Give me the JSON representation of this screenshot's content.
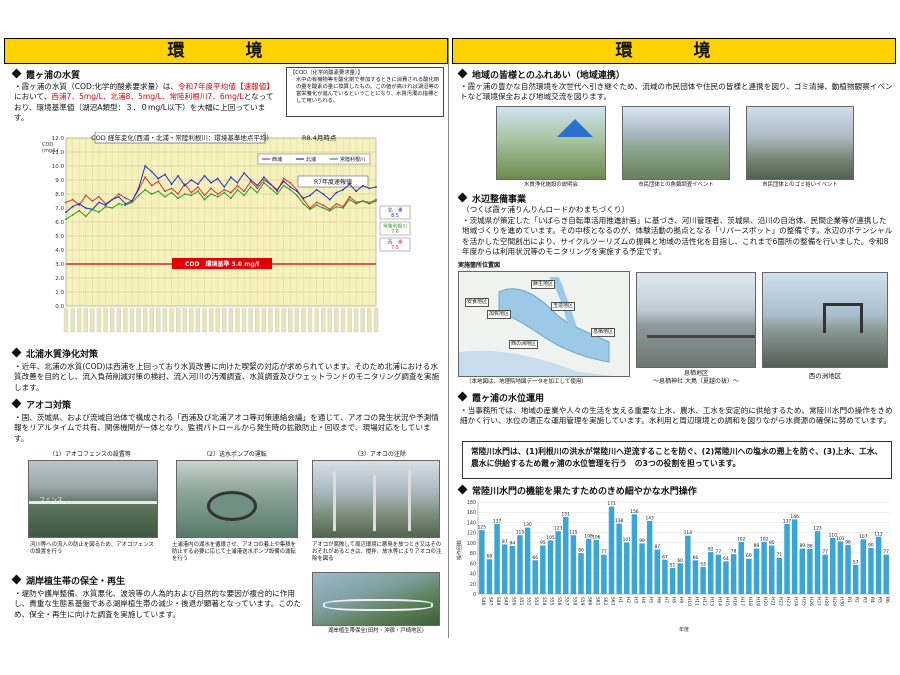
{
  "headers": {
    "left": "環　境",
    "right": "環　境"
  },
  "left": {
    "s1": {
      "title": "霞ヶ浦の水質",
      "text_a": "・霞ヶ浦の水質（COD:化学的酸素要求量）は、",
      "text_b": "令和7年度平均値",
      "text_c": "【速報値】",
      "text_d": "において、",
      "text_e": "西浦7．5mg/L、北浦8．5mg/L、常陸利根川7．6mg/L",
      "text_f": "となっており、環境基準値（湖沼A類型：３．０mg/L以下）を大幅に上回っています。",
      "note_title": "【COD（化学的酸素要求量）】",
      "note_text": "水中の有機物等を酸化剤で参加するときに消費される酸化剤の量を酸素の量に換算したもの。この値が高ければ湖沼等の富栄養化が進んでいるということになり、水質汚濁の指標として用いられる。"
    },
    "chart": {
      "title": "COD 経年変化(西浦・北浦・常陸利根川：環境基準地点平均)",
      "asof": "R8.4月時点",
      "ylabel": "COD\n(mg/L)",
      "legend": [
        "西浦",
        "北浦",
        "常陸利根川"
      ],
      "r7": "R7年度速報値",
      "baseline": "COD　環境基準 3.0 mg/l",
      "end_labels": [
        {
          "name": "北　浦",
          "value": "8.5"
        },
        {
          "name": "常陸利根川",
          "value": "7.6"
        },
        {
          "name": "西　浦",
          "value": "7.5"
        }
      ],
      "yticks": [
        "12.0",
        "11.0",
        "10.0",
        "9.0",
        "8.0",
        "7.0",
        "6.0",
        "5.0",
        "4.0",
        "3.0",
        "2.0",
        "1.0",
        "0.0"
      ]
    },
    "chart_data": {
      "type": "line",
      "ylim": [
        0,
        12
      ],
      "series": [
        {
          "name": "西浦",
          "color": "#e03030",
          "values": [
            7.4,
            7.6,
            7.2,
            7.9,
            7.5,
            7.8,
            7.3,
            7.6,
            8.0,
            7.7,
            7.5,
            8.3,
            9.2,
            8.6,
            8.9,
            8.2,
            8.4,
            8.0,
            8.7,
            8.1,
            8.5,
            7.9,
            8.4,
            8.0,
            8.3,
            8.1,
            8.6,
            8.2,
            8.9,
            8.4,
            9.0,
            8.7,
            8.2,
            9.1,
            8.8,
            8.3,
            7.6,
            7.0,
            7.4,
            7.2,
            6.9,
            7.3,
            7.1,
            7.8,
            7.4,
            7.5,
            7.3,
            7.5
          ]
        },
        {
          "name": "北浦",
          "color": "#2030c0",
          "values": [
            6.7,
            7.1,
            7.3,
            7.0,
            6.9,
            7.4,
            7.2,
            7.6,
            7.8,
            7.3,
            7.5,
            8.4,
            10.0,
            9.6,
            9.1,
            9.4,
            8.7,
            9.3,
            8.6,
            9.0,
            8.7,
            9.3,
            8.8,
            9.1,
            8.5,
            9.2,
            8.8,
            9.5,
            9.0,
            8.6,
            9.2,
            8.7,
            8.3,
            8.9,
            8.5,
            8.2,
            7.7,
            7.9,
            8.3,
            8.0,
            7.6,
            8.1,
            8.3,
            8.7,
            8.2,
            8.6,
            8.4,
            8.5
          ]
        },
        {
          "name": "常陸利根川",
          "color": "#2a9a2a",
          "values": [
            6.2,
            6.5,
            6.8,
            6.4,
            6.9,
            6.7,
            7.1,
            7.0,
            7.3,
            7.2,
            7.4,
            7.9,
            8.3,
            8.0,
            8.2,
            7.8,
            8.1,
            7.7,
            8.0,
            7.9,
            8.2,
            7.6,
            8.0,
            7.8,
            8.1,
            7.7,
            8.3,
            7.9,
            8.5,
            8.1,
            8.8,
            8.4,
            8.0,
            8.6,
            8.3,
            7.9,
            7.3,
            6.9,
            7.2,
            7.0,
            6.8,
            7.1,
            7.0,
            7.6,
            7.3,
            7.5,
            7.4,
            7.6
          ]
        }
      ],
      "threshold": 3.0
    },
    "s2": {
      "title": "北浦水質浄化対策",
      "text": "・近年、北浦の水質(COD)は西浦を上回っており水質改善に向けた喫緊の対応が求められています。そのため北浦における水質改善を目的とし、流入負荷削減対策の検討、流入河川の汚濁調査、水質調査及びウェットランドのモニタリング調査を実施します。"
    },
    "s3": {
      "title": "アオコ対策",
      "text": "・国、茨城県、および流域自治体で構成される「西浦及び北浦アオコ等対策連絡会議」を通じて、アオコの発生状況や予測情報をリアルタイムで共有、関係機関が一体となり、監視パトロールから発生時の拡散防止・回収まで、現場対応をしています。",
      "photos": [
        {
          "title": "（1）アオコフェンスの設置等",
          "caption": "河川等への流入の防止を図るため、アオコフェンスの設置を行う"
        },
        {
          "title": "（2）送水ポンプの運転",
          "caption": "土浦港内の湖水を循環させ、アオコの着上や集積を防止する必要に応じて土浦港送水ポンプ設備の運転を行う"
        },
        {
          "title": "（3）アオコの注除",
          "caption": "アオコが腐敗して周辺環境に悪臭を放つとき又はそのおそれがあるときは、撹拌、放水等によりアオコの注除を図る"
        }
      ],
      "fence_label": "フェンス"
    },
    "s4": {
      "title": "湖岸植生帯の保全・再生",
      "text": "・堤防や護岸整備、水質悪化、波浪等の人為的および自然的な要因が複合的に作用し、貴重な生態系基盤である湖岸植生帯の減少・後退が顕著となっています。このため、保全・再生に向けた調査を実施しています。",
      "photo_caption": "湖岸植生帯保全(田村・沖宿・戸崎地区)"
    }
  },
  "right": {
    "s1": {
      "title": "地域の皆様とのふれあい（地域連携）",
      "text": "・霞ヶ浦の豊かな自然環境を次世代へ引き継ぐため、流域の市民団体や住民の皆様と連携を図り、ゴミ清掃、動植物観察イベントなど環境保全および地域交流を図ります。",
      "photos": [
        "水質浄化施設の説明会",
        "市民団体との魚類調査イベント",
        "市民団体とのゴミ拾いイベント"
      ]
    },
    "s2": {
      "title": "水辺整備事業",
      "subtitle": "（つくば霞ヶ浦りんりんロードかわまちづくり）",
      "text": "・茨城県が策定した「いばらき自転車活用推進計画」に基づき、河川管理者、茨城県、沿川の自治体、民間企業等が連携した地域づくりを進めています。その中核となるのが、体験活動の拠点となる「リバースポット」の整備です。水辺のポテンシャルを活かした空間創出により、サイクルツーリズムの振興と地域の活性化を目指し、これまで6箇所の整備を行いました。令和8年度からは利用状況等のモニタリングを実施する予定です。",
      "map_title": "実施箇所位置図",
      "map_labels": [
        "安食地区",
        "麻生地区",
        "加賀地区",
        "玉造地区",
        "息栖地区",
        "西の洲地区"
      ],
      "map_note": "（本地図は、地理院地図データを加工して使用）",
      "photo1": "息栖地区\n～息栖神社 大鳥（夏越の祓）～",
      "photo2": "西の洲地区"
    },
    "s3": {
      "title": "霞ヶ浦の水位運用",
      "text": "・当事務所では、地域の産業や人々の生活を支える重要な上水、農水、工水を安定的に供給するため、常陸川水門の操作をきめ細かく行い、水位の適正な運用管理を実施しています。水利用と周辺環境との調和を図りながら水資源の確保に努めています。",
      "highlight": "常陸川水門は、(1)利根川の洪水が常陸川へ逆流することを防ぐ、(2)常陸川への塩水の遡上を防ぐ、(3)上水、工水、農水に供給するため霞ヶ浦の水位管理を行う　の3つの役割を担っています。"
    },
    "s4": {
      "title": "常陸川水門の機能を果たすためのきめ細やかな水門操作",
      "ylabel": "操作回数",
      "xlabel": "年度"
    },
    "chart_data": {
      "type": "bar",
      "categories": [
        "S46",
        "S47",
        "S48",
        "S49",
        "S50",
        "S51",
        "S52",
        "S53",
        "S54",
        "S55",
        "S56",
        "S57",
        "S58",
        "S59",
        "S60",
        "S61",
        "S62",
        "S63",
        "H1",
        "H2",
        "H3",
        "H4",
        "H5",
        "H6",
        "H7",
        "H8",
        "H9",
        "H10",
        "H11",
        "H12",
        "H13",
        "H14",
        "H15",
        "H16",
        "H17",
        "H18",
        "H19",
        "H20",
        "H21",
        "H22",
        "H23",
        "H24",
        "H25",
        "H26",
        "H27",
        "H28",
        "H29",
        "H30",
        "R1",
        "R2",
        "R3",
        "R4",
        "R5",
        "R6"
      ],
      "values": [
        125,
        68,
        137,
        97,
        94,
        115,
        130,
        66,
        95,
        105,
        123,
        151,
        115,
        80,
        108,
        106,
        77,
        171,
        138,
        101,
        156,
        99,
        143,
        87,
        67,
        51,
        60,
        114,
        66,
        53,
        82,
        77,
        64,
        78,
        102,
        69,
        89,
        102,
        95,
        71,
        137,
        146,
        89,
        88,
        123,
        77,
        110,
        103,
        96,
        57,
        107,
        90,
        112,
        77
      ],
      "ylim": [
        0,
        180
      ],
      "ylabel": "操作回数",
      "xlabel": "年度",
      "yticks": [
        180,
        160,
        140,
        120,
        100,
        80,
        60,
        40,
        20,
        0
      ],
      "color": "#3aa6d8"
    }
  }
}
